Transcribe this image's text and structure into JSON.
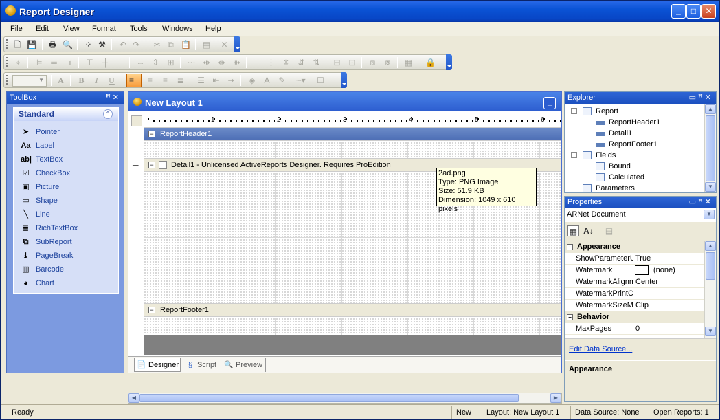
{
  "window": {
    "title": "Report Designer"
  },
  "menu": [
    "File",
    "Edit",
    "View",
    "Format",
    "Tools",
    "Windows",
    "Help"
  ],
  "toolbox": {
    "title": "ToolBox",
    "group": "Standard",
    "items": [
      {
        "label": "Pointer",
        "icon": "pointer-icon",
        "glyph": "➤"
      },
      {
        "label": "Label",
        "icon": "label-icon",
        "glyph": "Aa"
      },
      {
        "label": "TextBox",
        "icon": "textbox-icon",
        "glyph": "ab|"
      },
      {
        "label": "CheckBox",
        "icon": "checkbox-icon",
        "glyph": "☑"
      },
      {
        "label": "Picture",
        "icon": "picture-icon",
        "glyph": "▣"
      },
      {
        "label": "Shape",
        "icon": "shape-icon",
        "glyph": "▭"
      },
      {
        "label": "Line",
        "icon": "line-icon",
        "glyph": "╲"
      },
      {
        "label": "RichTextBox",
        "icon": "richtextbox-icon",
        "glyph": "≣"
      },
      {
        "label": "SubReport",
        "icon": "subreport-icon",
        "glyph": "⧉"
      },
      {
        "label": "PageBreak",
        "icon": "pagebreak-icon",
        "glyph": "⤓"
      },
      {
        "label": "Barcode",
        "icon": "barcode-icon",
        "glyph": "▥"
      },
      {
        "label": "Chart",
        "icon": "chart-icon",
        "glyph": "◕"
      }
    ]
  },
  "document": {
    "title": "New Layout 1",
    "ruler_marks": [
      "1",
      "2",
      "3",
      "4",
      "5",
      "6"
    ],
    "bands": {
      "header": "ReportHeader1",
      "detail": "Detail1  -  Unlicensed ActiveReports Designer. Requires ProEdition",
      "footer": "ReportFooter1"
    },
    "tabs": [
      "Designer",
      "Script",
      "Preview"
    ]
  },
  "tooltip": {
    "line1": "2ad.png",
    "line2": "Type: PNG Image",
    "line3": "Size: 51.9 KB",
    "line4": "Dimension: 1049 x 610 pixels"
  },
  "explorer": {
    "title": "Explorer",
    "report": "Report",
    "sections": [
      "ReportHeader1",
      "Detail1",
      "ReportFooter1"
    ],
    "fields": "Fields",
    "field_items": [
      "Bound",
      "Calculated"
    ],
    "parameters": "Parameters"
  },
  "properties": {
    "title": "Properties",
    "object": "ARNet Document",
    "cat_appearance": "Appearance",
    "rows_appearance": [
      {
        "name": "ShowParameterU",
        "value": "True"
      },
      {
        "name": "Watermark",
        "value": "(none)"
      },
      {
        "name": "WatermarkAlignm",
        "value": "Center"
      },
      {
        "name": "WatermarkPrintC",
        "value": ""
      },
      {
        "name": "WatermarkSizeM",
        "value": "Clip"
      }
    ],
    "cat_behavior": "Behavior",
    "rows_behavior": [
      {
        "name": "MaxPages",
        "value": "0"
      }
    ],
    "link": "Edit Data Source...",
    "desc_title": "Appearance"
  },
  "status": {
    "ready": "Ready",
    "mode": "New",
    "layout": "Layout: New Layout 1",
    "datasource": "Data Source: None",
    "open": "Open Reports: 1"
  }
}
